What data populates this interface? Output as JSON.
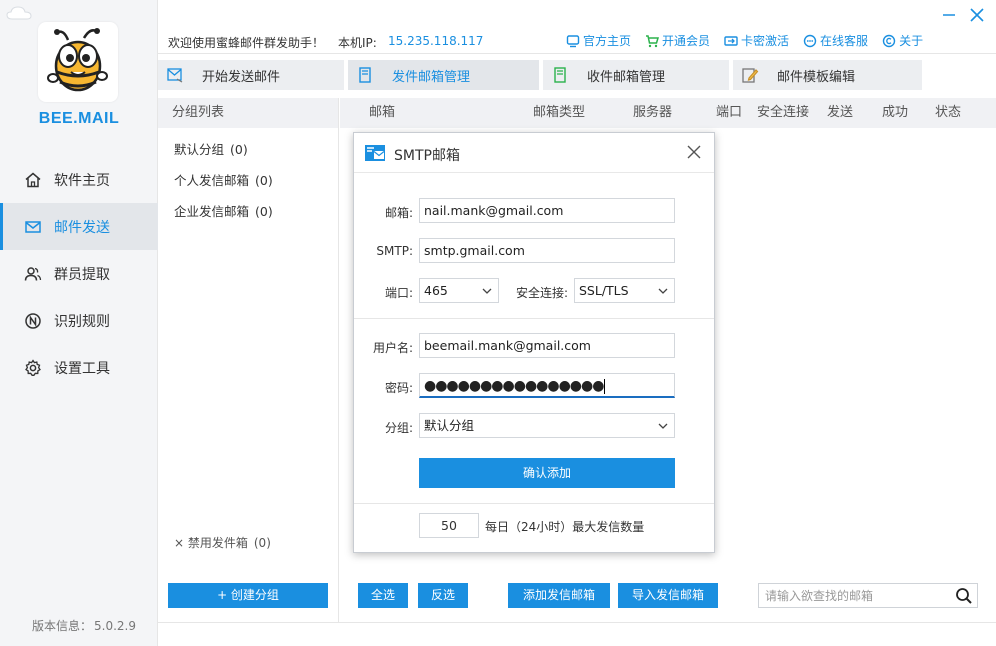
{
  "app": {
    "brand": "BEE.MAIL",
    "version_label": "版本信息：",
    "version": "5.0.2.9"
  },
  "nav": [
    {
      "label": "软件主页",
      "icon": "home-icon",
      "active": false
    },
    {
      "label": "邮件发送",
      "icon": "mail-icon",
      "active": true
    },
    {
      "label": "群员提取",
      "icon": "users-icon",
      "active": false
    },
    {
      "label": "识别规则",
      "icon": "rule-icon",
      "active": false
    },
    {
      "label": "设置工具",
      "icon": "gear-icon",
      "active": false
    }
  ],
  "topbar": {
    "welcome": "欢迎使用蜜蜂邮件群发助手！",
    "ip_label": "本机IP:",
    "ip": "15.235.118.117",
    "links": [
      "官方主页",
      "开通会员",
      "卡密激活",
      "在线客服",
      "关于"
    ]
  },
  "tabs": [
    {
      "label": "开始发送邮件",
      "active": false
    },
    {
      "label": "发件邮箱管理",
      "active": true
    },
    {
      "label": "收件邮箱管理",
      "active": false
    },
    {
      "label": "邮件模板编辑",
      "active": false
    }
  ],
  "groups": {
    "header": "分组列表",
    "items": [
      {
        "label": "默认分组",
        "count": "(0)"
      },
      {
        "label": "个人发信邮箱",
        "count": "(0)"
      },
      {
        "label": "企业发信邮箱",
        "count": "(0)"
      }
    ],
    "disabled": {
      "label": "× 禁用发件箱",
      "count": "(0)"
    },
    "create_button": "+ 创建分组"
  },
  "table": {
    "columns": [
      "邮箱",
      "邮箱类型",
      "服务器",
      "端口",
      "安全连接",
      "发送",
      "成功",
      "状态"
    ]
  },
  "toolbar": {
    "select_all": "全选",
    "invert": "反选",
    "add_sender": "添加发信邮箱",
    "import_sender": "导入发信邮箱",
    "search_placeholder": "请输入欲查找的邮箱"
  },
  "dialog": {
    "title": "SMTP邮箱",
    "email_label": "邮箱:",
    "email": "nail.mank@gmail.com",
    "smtp_label": "SMTP:",
    "smtp": "smtp.gmail.com",
    "port_label": "端口:",
    "port": "465",
    "security_label": "安全连接:",
    "security": "SSL/TLS",
    "username_label": "用户名:",
    "username": "beemail.mank@gmail.com",
    "password_label": "密码:",
    "password_mask": "●●●●●●●●●●●●●●●●",
    "group_label": "分组:",
    "group": "默认分组",
    "confirm_button": "确认添加",
    "daily_limit": "50",
    "daily_limit_text": "每日（24小时）最大发信数量"
  },
  "colors": {
    "accent": "#1a8fe0"
  }
}
